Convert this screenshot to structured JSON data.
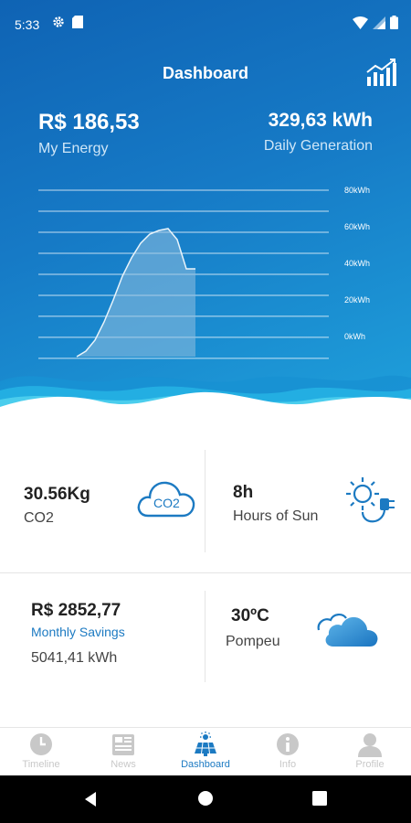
{
  "status": {
    "time": "5:33",
    "icons_left": [
      "gear-icon",
      "sim-icon"
    ],
    "icons_right": [
      "wifi-icon",
      "signal-icon",
      "battery-icon"
    ]
  },
  "header": {
    "title": "Dashboard"
  },
  "summary": {
    "energy_value": "R$  186,53",
    "energy_label": "My Energy",
    "generation_value": "329,63 kWh",
    "generation_label": "Daily Generation"
  },
  "chart_data": {
    "type": "area",
    "y_ticks": [
      "80kWh",
      "60kWh",
      "40kWh",
      "20kWh",
      "0kWh"
    ],
    "ylim": [
      0,
      80
    ],
    "x": [
      0,
      1,
      2,
      3,
      4,
      5,
      6,
      7,
      8,
      9,
      10,
      11,
      12,
      13
    ],
    "values": [
      -12,
      -8,
      -2,
      8,
      20,
      33,
      43,
      51,
      56,
      58,
      59,
      53,
      37,
      37
    ],
    "grid": true,
    "colors": {
      "line": "#e9f4fb",
      "fill": "#8fbddf"
    }
  },
  "cards": {
    "co2": {
      "value": "30.56Kg",
      "label": "CO2",
      "icon": "co2-cloud-icon",
      "icon_text": "CO2"
    },
    "sun": {
      "value": "8h",
      "label": "Hours of Sun",
      "icon": "sun-plug-icon"
    },
    "savings": {
      "value": "R$ 2852,77",
      "label": "Monthly Savings",
      "kwh": "5041,41  kWh"
    },
    "weather": {
      "value": "30ºC",
      "label": "Pompeu",
      "icon": "cloud-icon"
    }
  },
  "nav": {
    "items": [
      {
        "label": "Timeline",
        "icon": "clock-icon"
      },
      {
        "label": "News",
        "icon": "newspaper-icon"
      },
      {
        "label": "Dashboard",
        "icon": "solar-panel-icon",
        "active": true
      },
      {
        "label": "Info",
        "icon": "info-icon"
      },
      {
        "label": "Profile",
        "icon": "user-icon"
      }
    ]
  },
  "colors": {
    "accent": "#1c7ac2",
    "hero_top": "#0f63b4",
    "hero_bottom": "#1fa2dc",
    "inactive": "#c8c8c8"
  }
}
